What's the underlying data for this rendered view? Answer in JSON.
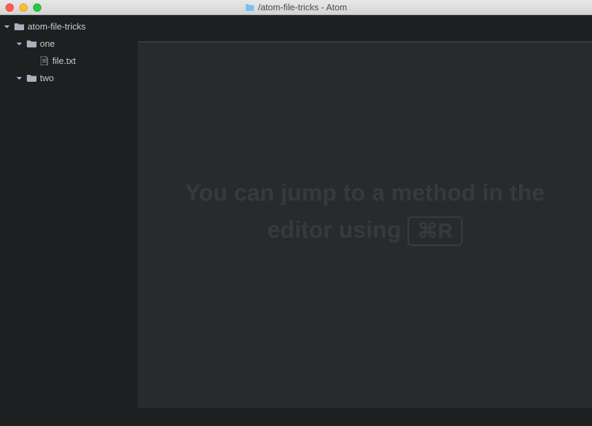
{
  "titlebar": {
    "folder_icon": "folder",
    "title": "/atom-file-tricks - Atom"
  },
  "tree": {
    "root": {
      "name": "atom-file-tricks",
      "expanded": true
    },
    "items": [
      {
        "name": "one",
        "type": "folder",
        "expanded": true,
        "indent": 1
      },
      {
        "name": "file.txt",
        "type": "file",
        "indent": 2
      },
      {
        "name": "two",
        "type": "folder",
        "expanded": true,
        "indent": 1
      }
    ]
  },
  "editor": {
    "hint_prefix": "You can jump to a method in the editor using ",
    "hint_kbd": "⌘R"
  }
}
